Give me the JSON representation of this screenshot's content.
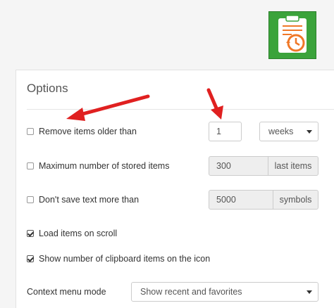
{
  "header": {
    "app_icon": "clipboard-history-icon"
  },
  "options": {
    "title": "Options",
    "remove_older": {
      "label": "Remove items older than",
      "checked": false,
      "value": "1",
      "unit": "weeks"
    },
    "max_items": {
      "label": "Maximum number of stored items",
      "checked": false,
      "value": "300",
      "suffix": "last items"
    },
    "max_text": {
      "label": "Don't save text more than",
      "checked": false,
      "value": "5000",
      "suffix": "symbols"
    },
    "load_on_scroll": {
      "label": "Load items on scroll",
      "checked": true
    },
    "show_count": {
      "label": "Show number of clipboard items on the icon",
      "checked": true
    },
    "context_menu": {
      "label": "Context menu mode",
      "value": "Show recent and favorites"
    }
  },
  "colors": {
    "accent_green": "#3ba33b",
    "arrow_red": "#e02020",
    "icon_orange": "#f07828"
  }
}
